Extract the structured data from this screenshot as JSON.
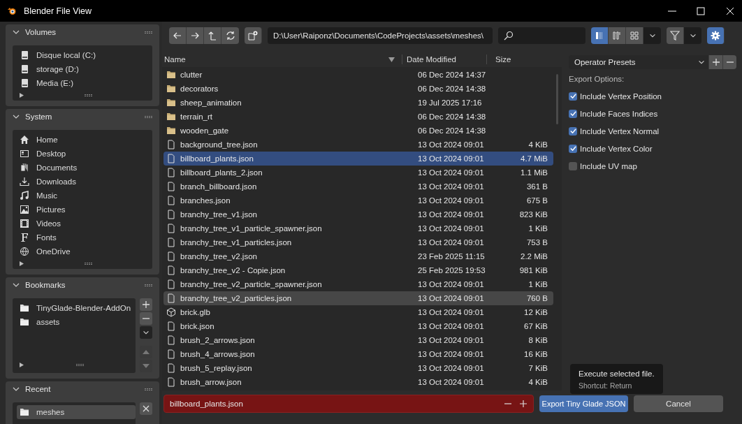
{
  "window": {
    "title": "Blender File View"
  },
  "sidebar": {
    "panels": [
      {
        "title": "Volumes",
        "expanded": true,
        "items": [
          {
            "label": "Disque local (C:)",
            "kind": "drive",
            "selected": false
          },
          {
            "label": "storage (D:)",
            "kind": "drive",
            "selected": false
          },
          {
            "label": "Media (E:)",
            "kind": "drive",
            "selected": false
          }
        ]
      },
      {
        "title": "System",
        "expanded": true,
        "items": [
          {
            "label": "Home",
            "kind": "home",
            "selected": false
          },
          {
            "label": "Desktop",
            "kind": "desktop",
            "selected": false
          },
          {
            "label": "Documents",
            "kind": "documents",
            "selected": false
          },
          {
            "label": "Downloads",
            "kind": "downloads",
            "selected": false
          },
          {
            "label": "Music",
            "kind": "music",
            "selected": false
          },
          {
            "label": "Pictures",
            "kind": "pictures",
            "selected": false
          },
          {
            "label": "Videos",
            "kind": "videos",
            "selected": false
          },
          {
            "label": "Fonts",
            "kind": "fonts",
            "selected": false
          },
          {
            "label": "OneDrive",
            "kind": "globe",
            "selected": false
          }
        ]
      },
      {
        "title": "Bookmarks",
        "expanded": true,
        "items": [
          {
            "label": "TinyGlade-Blender-AddOn",
            "kind": "folder",
            "selected": false
          },
          {
            "label": "assets",
            "kind": "folder",
            "selected": false
          }
        ]
      },
      {
        "title": "Recent",
        "expanded": true,
        "items": [
          {
            "label": "meshes",
            "kind": "folder",
            "selected": true
          }
        ]
      }
    ]
  },
  "toolbar": {
    "path": "D:\\User\\Raiponz\\Documents\\CodeProjects\\assets\\meshes\\",
    "view_modes": [
      {
        "kind": "list",
        "selected": true
      },
      {
        "kind": "columns",
        "selected": false
      },
      {
        "kind": "grid",
        "selected": false
      }
    ],
    "settings_on": true
  },
  "table": {
    "columns": [
      "Name",
      "Date Modified",
      "Size"
    ],
    "rows": [
      {
        "name": "clutter",
        "kind": "folder",
        "date": "06 Dec 2024 14:37",
        "size": "",
        "selected": false,
        "hovered": false
      },
      {
        "name": "decorators",
        "kind": "folder",
        "date": "06 Dec 2024 14:38",
        "size": "",
        "selected": false,
        "hovered": false
      },
      {
        "name": "sheep_animation",
        "kind": "folder",
        "date": "19 Jul 2025 17:16",
        "size": "",
        "selected": false,
        "hovered": false
      },
      {
        "name": "terrain_rt",
        "kind": "folder",
        "date": "06 Dec 2024 14:38",
        "size": "",
        "selected": false,
        "hovered": false
      },
      {
        "name": "wooden_gate",
        "kind": "folder",
        "date": "06 Dec 2024 14:38",
        "size": "",
        "selected": false,
        "hovered": false
      },
      {
        "name": "background_tree.json",
        "kind": "file",
        "date": "13 Oct 2024 09:01",
        "size": "4 KiB",
        "selected": false,
        "hovered": false
      },
      {
        "name": "billboard_plants.json",
        "kind": "file",
        "date": "13 Oct 2024 09:01",
        "size": "4.7 MiB",
        "selected": true,
        "hovered": false
      },
      {
        "name": "billboard_plants_2.json",
        "kind": "file",
        "date": "13 Oct 2024 09:01",
        "size": "1.1 MiB",
        "selected": false,
        "hovered": false
      },
      {
        "name": "branch_billboard.json",
        "kind": "file",
        "date": "13 Oct 2024 09:01",
        "size": "361 B",
        "selected": false,
        "hovered": false
      },
      {
        "name": "branches.json",
        "kind": "file",
        "date": "13 Oct 2024 09:01",
        "size": "675 B",
        "selected": false,
        "hovered": false
      },
      {
        "name": "branchy_tree_v1.json",
        "kind": "file",
        "date": "13 Oct 2024 09:01",
        "size": "823 KiB",
        "selected": false,
        "hovered": false
      },
      {
        "name": "branchy_tree_v1_particle_spawner.json",
        "kind": "file",
        "date": "13 Oct 2024 09:01",
        "size": "1 KiB",
        "selected": false,
        "hovered": false
      },
      {
        "name": "branchy_tree_v1_particles.json",
        "kind": "file",
        "date": "13 Oct 2024 09:01",
        "size": "753 B",
        "selected": false,
        "hovered": false
      },
      {
        "name": "branchy_tree_v2.json",
        "kind": "file",
        "date": "23 Feb 2025 11:15",
        "size": "2.2 MiB",
        "selected": false,
        "hovered": false
      },
      {
        "name": "branchy_tree_v2 - Copie.json",
        "kind": "file",
        "date": "25 Feb 2025 19:53",
        "size": "981 KiB",
        "selected": false,
        "hovered": false
      },
      {
        "name": "branchy_tree_v2_particle_spawner.json",
        "kind": "file",
        "date": "13 Oct 2024 09:01",
        "size": "1 KiB",
        "selected": false,
        "hovered": false
      },
      {
        "name": "branchy_tree_v2_particles.json",
        "kind": "file",
        "date": "13 Oct 2024 09:01",
        "size": "760 B",
        "selected": false,
        "hovered": true
      },
      {
        "name": "brick.glb",
        "kind": "mesh",
        "date": "13 Oct 2024 09:01",
        "size": "12 KiB",
        "selected": false,
        "hovered": false
      },
      {
        "name": "brick.json",
        "kind": "file",
        "date": "13 Oct 2024 09:01",
        "size": "67 KiB",
        "selected": false,
        "hovered": false
      },
      {
        "name": "brush_2_arrows.json",
        "kind": "file",
        "date": "13 Oct 2024 09:01",
        "size": "8 KiB",
        "selected": false,
        "hovered": false
      },
      {
        "name": "brush_4_arrows.json",
        "kind": "file",
        "date": "13 Oct 2024 09:01",
        "size": "16 KiB",
        "selected": false,
        "hovered": false
      },
      {
        "name": "brush_5_replay.json",
        "kind": "file",
        "date": "13 Oct 2024 09:01",
        "size": "7 KiB",
        "selected": false,
        "hovered": false
      },
      {
        "name": "brush_arrow.json",
        "kind": "file",
        "date": "13 Oct 2024 09:01",
        "size": "4 KiB",
        "selected": false,
        "hovered": false
      }
    ]
  },
  "options": {
    "presets": "Operator Presets",
    "heading": "Export Options:",
    "items": [
      {
        "label": "Include Vertex Position",
        "checked": true
      },
      {
        "label": "Include Faces Indices",
        "checked": true
      },
      {
        "label": "Include Vertex Normal",
        "checked": true
      },
      {
        "label": "Include Vertex Color",
        "checked": true
      },
      {
        "label": "Include UV map",
        "checked": false
      }
    ]
  },
  "footer": {
    "filename": "billboard_plants.json",
    "filename_invalid": true,
    "execute_button": "Export Tiny Glade JSON",
    "cancel_button": "Cancel"
  },
  "tooltip": {
    "text": "Execute selected file.",
    "shortcut": "Shortcut: Return"
  }
}
